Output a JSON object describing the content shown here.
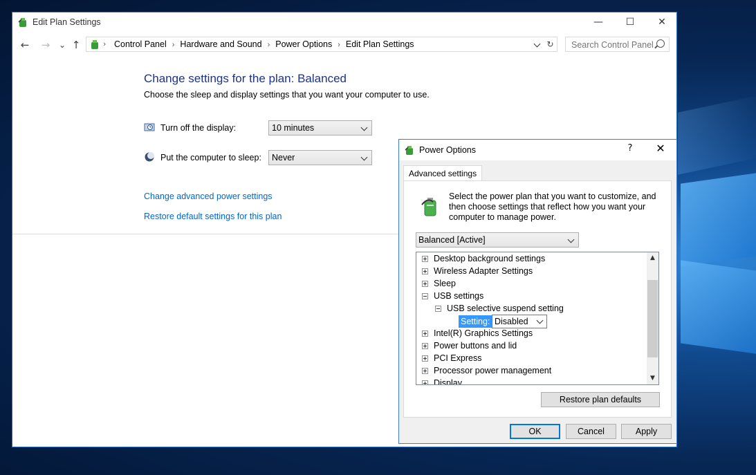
{
  "window": {
    "title": "Edit Plan Settings",
    "minimize_glyph": "—",
    "maximize_glyph": "☐",
    "close_glyph": "✕"
  },
  "nav": {
    "back_glyph": "←",
    "forward_glyph": "→",
    "recent_glyph": "⌄",
    "up_glyph": "↑"
  },
  "breadcrumb": {
    "items": [
      "Control Panel",
      "Hardware and Sound",
      "Power Options",
      "Edit Plan Settings"
    ],
    "separator": "›"
  },
  "search": {
    "placeholder": "Search Control Panel"
  },
  "refresh_glyph": "↻",
  "plan": {
    "heading": "Change settings for the plan: Balanced",
    "subheading": "Choose the sleep and display settings that you want your computer to use.",
    "display_label": "Turn off the display:",
    "display_value": "10 minutes",
    "sleep_label": "Put the computer to sleep:",
    "sleep_value": "Never",
    "advanced_link": "Change advanced power settings",
    "restore_link": "Restore default settings for this plan"
  },
  "dialog": {
    "title": "Power Options",
    "help_glyph": "?",
    "close_glyph": "✕",
    "tab": "Advanced settings",
    "intro": "Select the power plan that you want to customize, and then choose settings that reflect how you want your computer to manage power.",
    "plan_value": "Balanced [Active]",
    "tree": [
      "Desktop background settings",
      "Wireless Adapter Settings",
      "Sleep",
      "USB settings",
      "USB selective suspend setting",
      "Intel(R) Graphics Settings",
      "Power buttons and lid",
      "PCI Express",
      "Processor power management",
      "Display"
    ],
    "setting_label": "Setting:",
    "setting_value": "Disabled",
    "restore_button": "Restore plan defaults",
    "ok": "OK",
    "cancel": "Cancel",
    "apply": "Apply"
  },
  "colors": {
    "heading": "#1e3287",
    "link": "#0066cc",
    "selection": "#3399ff",
    "accent": "#0078d7"
  }
}
